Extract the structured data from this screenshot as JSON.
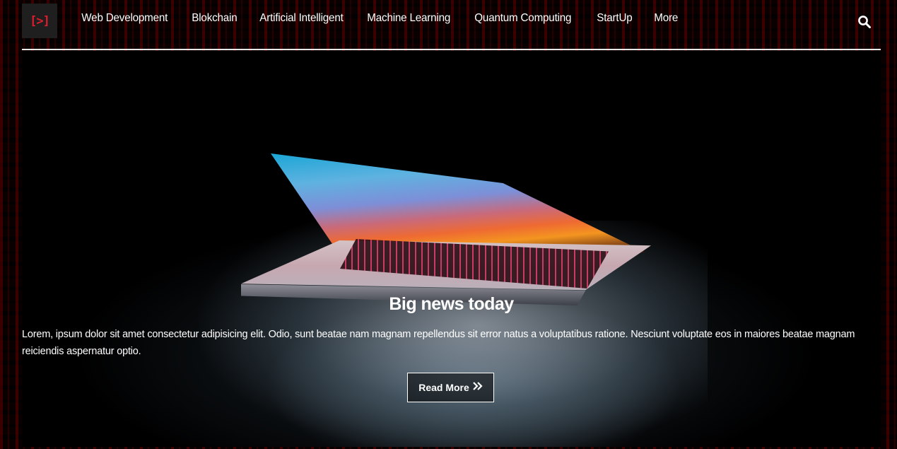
{
  "logo": {
    "text": "[>]"
  },
  "nav": {
    "items": [
      {
        "label": "Web Development"
      },
      {
        "label": "Blokchain"
      },
      {
        "label": "Artificial Intelligent"
      },
      {
        "label": "Machine Learning"
      },
      {
        "label": "Quantum Computing"
      },
      {
        "label": "StartUp"
      },
      {
        "label": "More"
      }
    ],
    "search_icon": "search-icon"
  },
  "hero": {
    "title": "Big news today",
    "text": "Lorem, ipsum dolor sit amet consectetur adipisicing elit. Odio, sunt beatae nam magnam repellendus sit error natus a voluptatibus ratione. Nesciunt voluptate eos in maiores beatae magnam reiciendis aspernatur optio.",
    "button_label": "Read More",
    "button_icon": "double-chevron-right-icon"
  },
  "colors": {
    "brand_red": "#e01d2f",
    "background": "#000000",
    "text": "#ffffff"
  }
}
